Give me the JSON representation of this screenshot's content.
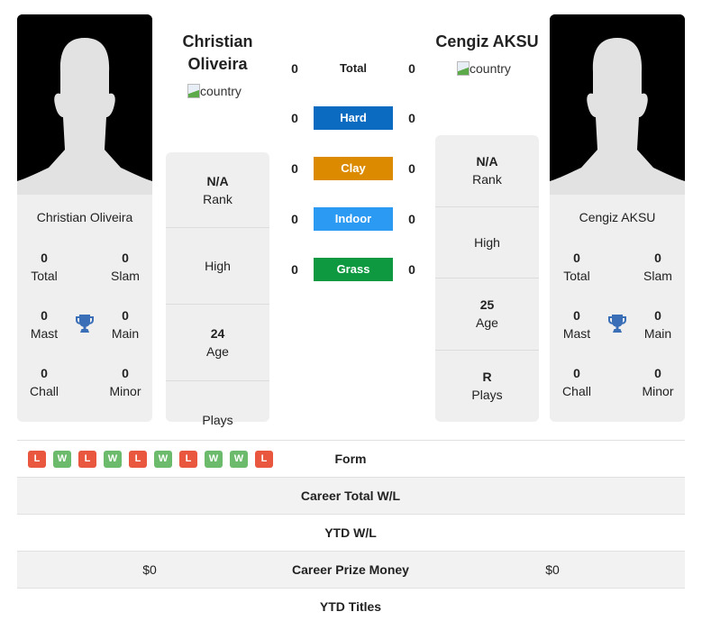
{
  "colors": {
    "hard": "#0a6bc1",
    "clay": "#dc8b00",
    "indoor": "#2b9af3",
    "grass": "#0e9941",
    "win": "#6cbb6c",
    "loss": "#e9573f",
    "trophy": "#3a6fb7"
  },
  "player1": {
    "name": "Christian Oliveira",
    "flag_alt": "country",
    "titles": {
      "total": {
        "value": "0",
        "label": "Total"
      },
      "slam": {
        "value": "0",
        "label": "Slam"
      },
      "mast": {
        "value": "0",
        "label": "Mast"
      },
      "main": {
        "value": "0",
        "label": "Main"
      },
      "chall": {
        "value": "0",
        "label": "Chall"
      },
      "minor": {
        "value": "0",
        "label": "Minor"
      }
    },
    "stats": {
      "rank": {
        "value": "N/A",
        "label": "Rank"
      },
      "high": {
        "value": "",
        "label": "High"
      },
      "age": {
        "value": "24",
        "label": "Age"
      },
      "plays": {
        "value": "",
        "label": "Plays"
      }
    }
  },
  "player2": {
    "name": "Cengiz AKSU",
    "flag_alt": "country",
    "titles": {
      "total": {
        "value": "0",
        "label": "Total"
      },
      "slam": {
        "value": "0",
        "label": "Slam"
      },
      "mast": {
        "value": "0",
        "label": "Mast"
      },
      "main": {
        "value": "0",
        "label": "Main"
      },
      "chall": {
        "value": "0",
        "label": "Chall"
      },
      "minor": {
        "value": "0",
        "label": "Minor"
      }
    },
    "stats": {
      "rank": {
        "value": "N/A",
        "label": "Rank"
      },
      "high": {
        "value": "",
        "label": "High"
      },
      "age": {
        "value": "25",
        "label": "Age"
      },
      "plays": {
        "value": "R",
        "label": "Plays"
      }
    }
  },
  "h2h": [
    {
      "label": "Total",
      "p1": "0",
      "p2": "0"
    },
    {
      "label": "Hard",
      "p1": "0",
      "p2": "0"
    },
    {
      "label": "Clay",
      "p1": "0",
      "p2": "0"
    },
    {
      "label": "Indoor",
      "p1": "0",
      "p2": "0"
    },
    {
      "label": "Grass",
      "p1": "0",
      "p2": "0"
    }
  ],
  "form": [
    "L",
    "W",
    "L",
    "W",
    "L",
    "W",
    "L",
    "W",
    "W",
    "L"
  ],
  "table": {
    "form_label": "Form",
    "career_wl": {
      "label": "Career Total W/L",
      "p1": "",
      "p2": ""
    },
    "ytd_wl": {
      "label": "YTD W/L",
      "p1": "",
      "p2": ""
    },
    "prize": {
      "label": "Career Prize Money",
      "p1": "$0",
      "p2": "$0"
    },
    "ytd_titles": {
      "label": "YTD Titles",
      "p1": "",
      "p2": ""
    }
  }
}
